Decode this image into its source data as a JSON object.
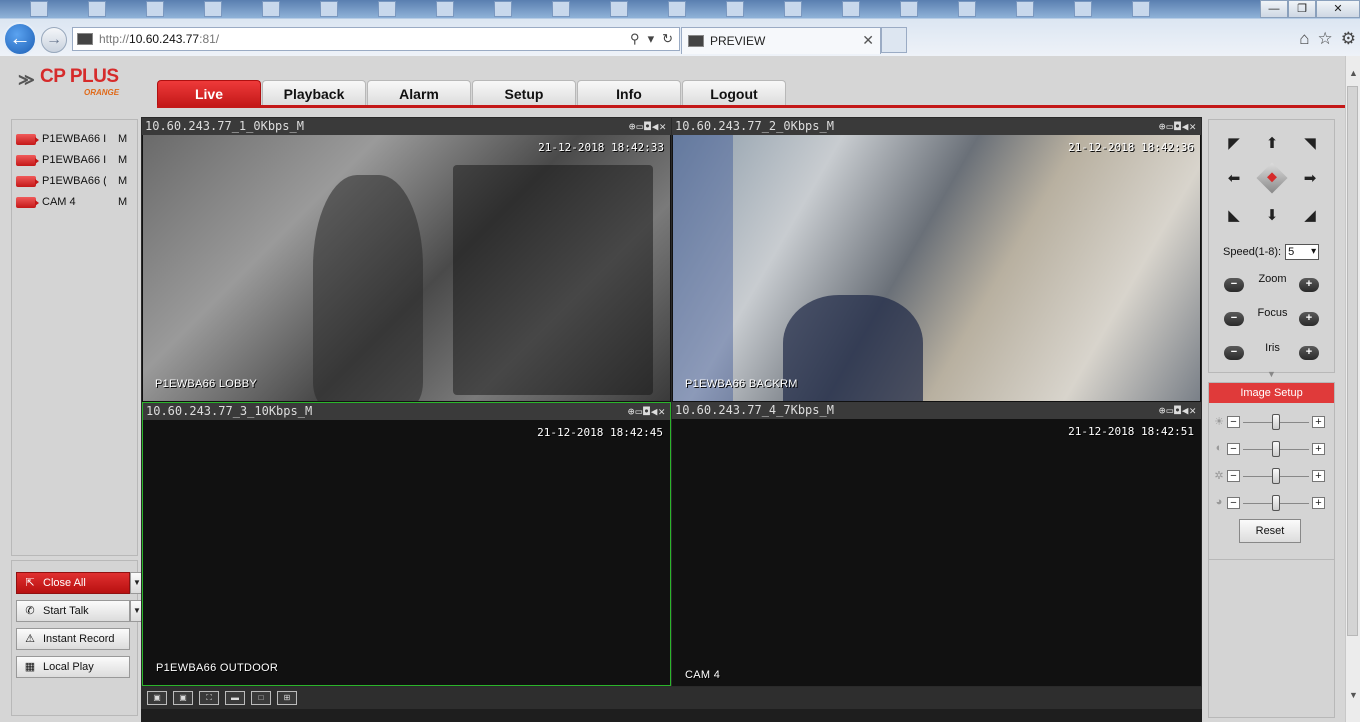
{
  "browser": {
    "url_prefix": "http://",
    "url_host": "10.60.243.77",
    "url_suffix": ":81/",
    "tab_title": "PREVIEW",
    "window_buttons": {
      "minimize": "—",
      "maximize": "❐",
      "close": "✕"
    },
    "toolbar_icons": [
      "home-icon",
      "star-icon",
      "gear-icon"
    ]
  },
  "logo": {
    "brand": "CP PLUS",
    "sub": "ORANGE"
  },
  "tabs": [
    {
      "label": "Live",
      "active": true
    },
    {
      "label": "Playback",
      "active": false
    },
    {
      "label": "Alarm",
      "active": false
    },
    {
      "label": "Setup",
      "active": false
    },
    {
      "label": "Info",
      "active": false
    },
    {
      "label": "Logout",
      "active": false
    }
  ],
  "devices": [
    {
      "name": "P1EWBA66 I",
      "flag": "M"
    },
    {
      "name": "P1EWBA66 I",
      "flag": "M"
    },
    {
      "name": "P1EWBA66 (",
      "flag": "M"
    },
    {
      "name": "CAM 4",
      "flag": "M"
    }
  ],
  "controls": {
    "close_all": "Close All",
    "start_talk": "Start Talk",
    "instant_record": "Instant Record",
    "local_play": "Local Play"
  },
  "panes": [
    {
      "header": "10.60.243.77_1_0Kbps_M",
      "timestamp": "21-12-2018 18:42:33",
      "label": "P1EWBA66 LOBBY",
      "feed": "bw"
    },
    {
      "header": "10.60.243.77_2_0Kbps_M",
      "timestamp": "21-12-2018 18:42:36",
      "label": "P1EWBA66 BACKRM",
      "feed": "color"
    },
    {
      "header": "10.60.243.77_3_10Kbps_M",
      "timestamp": "21-12-2018 18:42:45",
      "label": "P1EWBA66 OUTDOOR",
      "feed": "black"
    },
    {
      "header": "10.60.243.77_4_7Kbps_M",
      "timestamp": "21-12-2018 18:42:51",
      "label": "CAM 4",
      "feed": "black"
    }
  ],
  "pane_tools": "⊕▭◘◀✕",
  "ptz": {
    "speed_label": "Speed(1-8):",
    "speed_value": "5",
    "zoom": "Zoom",
    "focus": "Focus",
    "iris": "Iris",
    "minus": "−",
    "plus": "+"
  },
  "image_setup": {
    "title": "Image Setup",
    "sliders": [
      {
        "icon": "brightness-icon",
        "glyph": "☀",
        "value": 0.5
      },
      {
        "icon": "contrast-icon",
        "glyph": "◐",
        "value": 0.5
      },
      {
        "icon": "saturation-icon",
        "glyph": "✲",
        "value": 0.5
      },
      {
        "icon": "hue-icon",
        "glyph": "◕",
        "value": 0.5
      }
    ],
    "reset": "Reset"
  }
}
